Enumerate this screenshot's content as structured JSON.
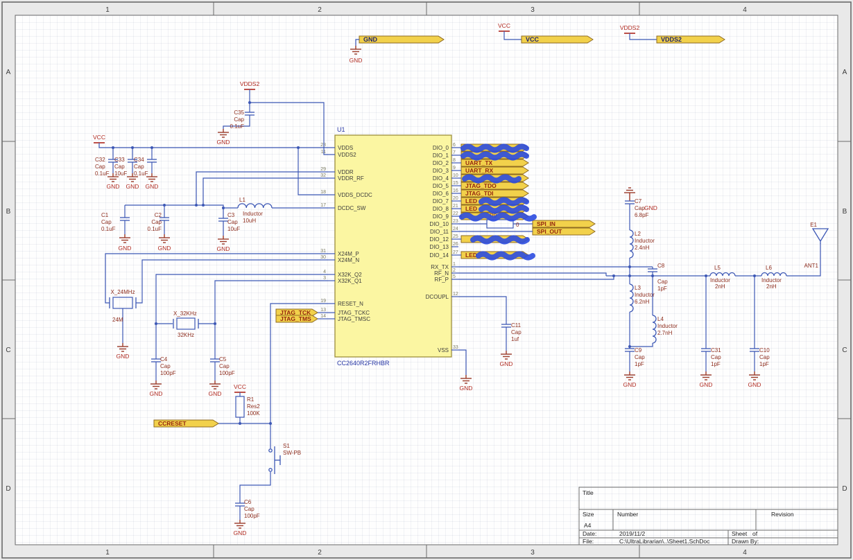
{
  "frame": {
    "columns": [
      "1",
      "2",
      "3",
      "4"
    ],
    "rows": [
      "A",
      "B",
      "C",
      "D"
    ]
  },
  "net_labels": {
    "gnd": "GND",
    "vcc": "VCC",
    "vdds2": "VDDS2"
  },
  "top_ports": [
    {
      "label": "GND"
    },
    {
      "label": "VCC"
    },
    {
      "label": "VDDS2"
    }
  ],
  "ic": {
    "designator": "U1",
    "part": "CC2640R2FRHBR",
    "left_pins": [
      {
        "num": "28",
        "name": "VDDS"
      },
      {
        "num": "11",
        "name": "VDDS2"
      },
      {
        "num": "29",
        "name": "VDDR"
      },
      {
        "num": "32",
        "name": "VDDR_RF"
      },
      {
        "num": "18",
        "name": "VDDS_DCDC"
      },
      {
        "num": "17",
        "name": "DCDC_SW"
      },
      {
        "num": "31",
        "name": "X24M_P"
      },
      {
        "num": "30",
        "name": "X24M_N"
      },
      {
        "num": "4",
        "name": "X32K_Q2"
      },
      {
        "num": "3",
        "name": "X32K_Q1"
      },
      {
        "num": "19",
        "name": "RESET_N"
      },
      {
        "num": "13",
        "name": "JTAG_TCKC"
      },
      {
        "num": "14",
        "name": "JTAG_TMSC"
      }
    ],
    "right_pins": [
      {
        "num": "6",
        "name": "DIO_0"
      },
      {
        "num": "7",
        "name": "DIO_1"
      },
      {
        "num": "8",
        "name": "DIO_2"
      },
      {
        "num": "9",
        "name": "DIO_3"
      },
      {
        "num": "10",
        "name": "DIO_4"
      },
      {
        "num": "15",
        "name": "DIO_5"
      },
      {
        "num": "16",
        "name": "DIO_6"
      },
      {
        "num": "20",
        "name": "DIO_7"
      },
      {
        "num": "21",
        "name": "DIO_8"
      },
      {
        "num": "22",
        "name": "DIO_9"
      },
      {
        "num": "23",
        "name": "DIO_10"
      },
      {
        "num": "24",
        "name": "DIO_11"
      },
      {
        "num": "25",
        "name": "DIO_12"
      },
      {
        "num": "26",
        "name": "DIO_13"
      },
      {
        "num": "27",
        "name": "DIO_14"
      },
      {
        "num": "1",
        "name": "RX_TX"
      },
      {
        "num": "2",
        "name": "RF_N"
      },
      {
        "num": "5",
        "name": "RF_P"
      },
      {
        "num": "12",
        "name": "DCOUPL"
      },
      {
        "num": "33",
        "name": "VSS"
      }
    ]
  },
  "ports": {
    "right": [
      {
        "label": "",
        "scribbled": true
      },
      {
        "label": "",
        "scribbled": true
      },
      {
        "label": "UART_TX",
        "scribbled": false
      },
      {
        "label": "UART_RX",
        "scribbled": false
      },
      {
        "label": "",
        "scribbled": true
      },
      {
        "label": "JTAG_TDO",
        "scribbled": false
      },
      {
        "label": "JTAG_TDI",
        "scribbled": false
      },
      {
        "label": "LED",
        "scribbled": true
      },
      {
        "label": "LED",
        "scribbled": true
      },
      {
        "label": "",
        "scribbled": true
      },
      {
        "label": "SPI_IN",
        "scribbled": false
      },
      {
        "label": "SPI_OUT",
        "scribbled": false
      },
      {
        "label": "",
        "scribbled": true
      },
      {
        "label": "LED",
        "scribbled": true
      }
    ],
    "left": [
      {
        "label": "JTAG_TCK"
      },
      {
        "label": "JTAG_TMS"
      },
      {
        "label": "CCRESET"
      }
    ]
  },
  "components": [
    {
      "ref": "C35",
      "type": "Cap",
      "value": "0.1uF"
    },
    {
      "ref": "C32",
      "type": "Cap",
      "value": "0.1uF"
    },
    {
      "ref": "C33",
      "type": "Cap",
      "value": "10uF"
    },
    {
      "ref": "C34",
      "type": "Cap",
      "value": "0.1uF"
    },
    {
      "ref": "C1",
      "type": "Cap",
      "value": "0.1uF"
    },
    {
      "ref": "C2",
      "type": "Cap",
      "value": "0.1uF"
    },
    {
      "ref": "C3",
      "type": "Cap",
      "value": "10uF"
    },
    {
      "ref": "L1",
      "type": "Inductor",
      "value": "10uH"
    },
    {
      "ref": "X_24MHz",
      "type": "",
      "value": "24M"
    },
    {
      "ref": "X_32KHz",
      "type": "",
      "value": "32KHz"
    },
    {
      "ref": "C4",
      "type": "Cap",
      "value": "100pF"
    },
    {
      "ref": "C5",
      "type": "Cap",
      "value": "100pF"
    },
    {
      "ref": "R1",
      "type": "Res2",
      "value": "100K"
    },
    {
      "ref": "S1",
      "type": "SW-PB",
      "value": ""
    },
    {
      "ref": "C6",
      "type": "Cap",
      "value": "100pF"
    },
    {
      "ref": "C11",
      "type": "Cap",
      "value": "1uf"
    },
    {
      "ref": "C7",
      "type": "Cap",
      "value": "6.8pF"
    },
    {
      "ref": "L2",
      "type": "Inductor",
      "value": "2.4nH"
    },
    {
      "ref": "C8",
      "type": "Cap",
      "value": "1pF"
    },
    {
      "ref": "L3",
      "type": "Inductor",
      "value": "6.2nH"
    },
    {
      "ref": "L4",
      "type": "Inductor",
      "value": "2.7nH"
    },
    {
      "ref": "C9",
      "type": "Cap",
      "value": "1pF"
    },
    {
      "ref": "C31",
      "type": "Cap",
      "value": "1pF"
    },
    {
      "ref": "C10",
      "type": "Cap",
      "value": "1pF"
    },
    {
      "ref": "L5",
      "type": "Inductor",
      "value": "2nH"
    },
    {
      "ref": "L6",
      "type": "Inductor",
      "value": "2nH"
    },
    {
      "ref": "R9",
      "type": "",
      "value": "0"
    },
    {
      "ref": "E1",
      "type": "",
      "value": "ANT1"
    }
  ],
  "title_block": {
    "title_label": "Title",
    "size_label": "Size",
    "size_value": "A4",
    "number_label": "Number",
    "revision_label": "Revision",
    "date_label": "Date:",
    "date_value": "2019/11/2",
    "file_label": "File:",
    "file_value": "C:\\UltraLibrarian\\..\\Sheet1.SchDoc",
    "sheet_label": "Sheet",
    "of_label": "of",
    "drawn_by_label": "Drawn By:"
  }
}
